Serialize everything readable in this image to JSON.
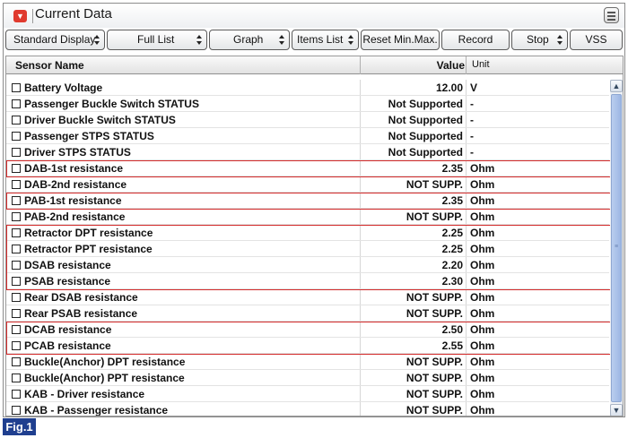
{
  "window": {
    "title": "Current Data",
    "collapse_icon": "chevron-down-icon",
    "menu_icon": "list-menu-icon"
  },
  "toolbar": {
    "standard_display": "Standard Display",
    "full_list": "Full List",
    "graph": "Graph",
    "items_list": "Items List",
    "reset_min_max": "Reset Min.Max.",
    "record": "Record",
    "stop": "Stop",
    "vss": "VSS"
  },
  "table": {
    "headers": {
      "name": "Sensor Name",
      "value": "Value",
      "unit": "Unit"
    },
    "rows": [
      {
        "name": "Battery Voltage",
        "value": "12.00",
        "unit": "V"
      },
      {
        "name": "Passenger Buckle Switch STATUS",
        "value": "Not Supported",
        "unit": "-"
      },
      {
        "name": "Driver Buckle Switch STATUS",
        "value": "Not Supported",
        "unit": "-"
      },
      {
        "name": "Passenger STPS STATUS",
        "value": "Not Supported",
        "unit": "-"
      },
      {
        "name": "Driver STPS STATUS",
        "value": "Not Supported",
        "unit": "-"
      },
      {
        "name": "DAB-1st resistance",
        "value": "2.35",
        "unit": "Ohm"
      },
      {
        "name": "DAB-2nd resistance",
        "value": "NOT SUPP.",
        "unit": "Ohm"
      },
      {
        "name": "PAB-1st resistance",
        "value": "2.35",
        "unit": "Ohm"
      },
      {
        "name": "PAB-2nd resistance",
        "value": "NOT SUPP.",
        "unit": "Ohm"
      },
      {
        "name": "Retractor DPT resistance",
        "value": "2.25",
        "unit": "Ohm"
      },
      {
        "name": "Retractor PPT resistance",
        "value": "2.25",
        "unit": "Ohm"
      },
      {
        "name": "DSAB resistance",
        "value": "2.20",
        "unit": "Ohm"
      },
      {
        "name": "PSAB resistance",
        "value": "2.30",
        "unit": "Ohm"
      },
      {
        "name": "Rear DSAB resistance",
        "value": "NOT SUPP.",
        "unit": "Ohm"
      },
      {
        "name": "Rear PSAB resistance",
        "value": "NOT SUPP.",
        "unit": "Ohm"
      },
      {
        "name": "DCAB resistance",
        "value": "2.50",
        "unit": "Ohm"
      },
      {
        "name": "PCAB resistance",
        "value": "2.55",
        "unit": "Ohm"
      },
      {
        "name": "Buckle(Anchor) DPT resistance",
        "value": "NOT SUPP.",
        "unit": "Ohm"
      },
      {
        "name": "Buckle(Anchor) PPT resistance",
        "value": "NOT SUPP.",
        "unit": "Ohm"
      },
      {
        "name": "KAB - Driver resistance",
        "value": "NOT SUPP.",
        "unit": "Ohm"
      },
      {
        "name": "KAB - Passenger resistance",
        "value": "NOT SUPP.",
        "unit": "Ohm"
      }
    ]
  },
  "highlight_color": "#d42c2c",
  "figure_label": "Fig.1"
}
